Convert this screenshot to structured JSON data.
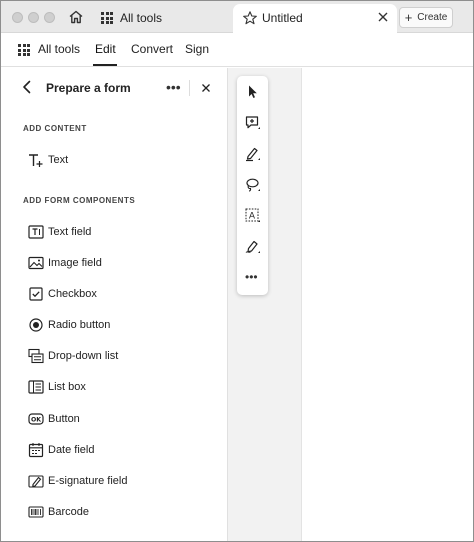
{
  "tabs": {
    "all_tools": "All tools",
    "active_title": "Untitled",
    "create_label": "Create"
  },
  "menubar": {
    "items": [
      "All tools",
      "Edit",
      "Convert",
      "Sign"
    ],
    "active": "Edit"
  },
  "panel": {
    "title": "Prepare a form",
    "section_add_content": "ADD CONTENT",
    "content_items": [
      {
        "label": "Text",
        "icon": "add-text-icon"
      }
    ],
    "section_form_components": "ADD FORM COMPONENTS",
    "form_items": [
      {
        "label": "Text field",
        "icon": "text-field-icon"
      },
      {
        "label": "Image field",
        "icon": "image-field-icon"
      },
      {
        "label": "Checkbox",
        "icon": "checkbox-icon"
      },
      {
        "label": "Radio button",
        "icon": "radio-button-icon"
      },
      {
        "label": "Drop-down list",
        "icon": "dropdown-list-icon"
      },
      {
        "label": "List box",
        "icon": "list-box-icon"
      },
      {
        "label": "Button",
        "icon": "button-ok-icon"
      },
      {
        "label": "Date field",
        "icon": "date-field-icon"
      },
      {
        "label": "E-signature field",
        "icon": "esignature-icon"
      },
      {
        "label": "Barcode",
        "icon": "barcode-icon"
      }
    ]
  },
  "floating_toolbar": {
    "tools": [
      "select-pointer-icon",
      "add-comment-icon",
      "highlight-pen-icon",
      "lasso-draw-icon",
      "text-box-select-icon",
      "sign-pen-icon",
      "more-icon"
    ]
  },
  "colors": {
    "tabbar_bg": "#e9e9e9",
    "canvas_gray": "#f2f2f2",
    "text": "#222222"
  }
}
